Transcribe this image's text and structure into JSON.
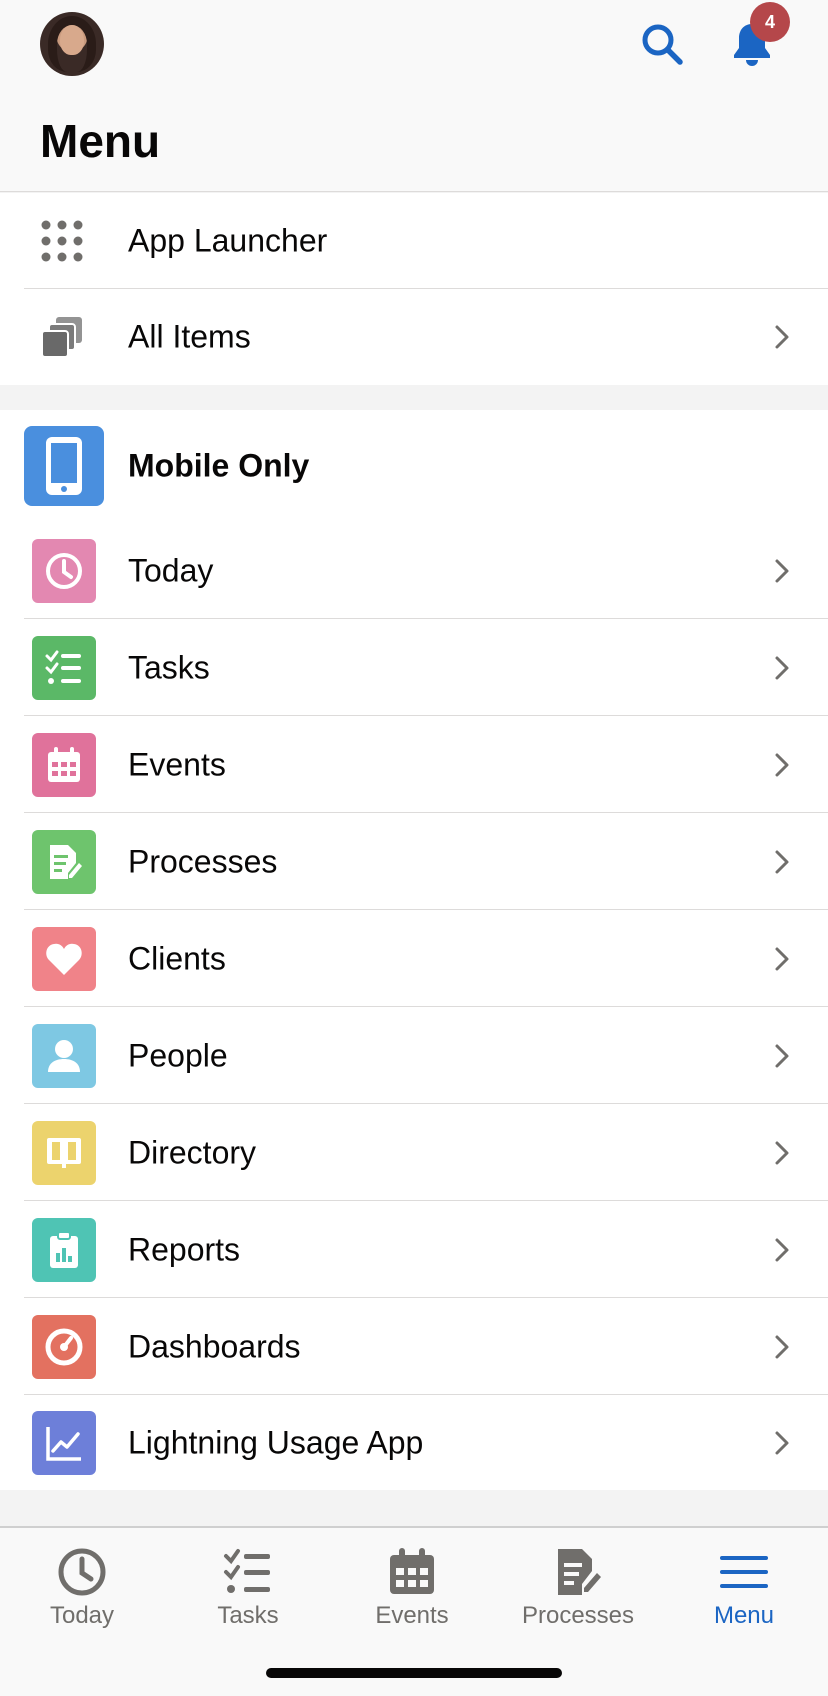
{
  "header": {
    "title": "Menu",
    "notification_count": "4"
  },
  "section1": {
    "items": [
      {
        "label": "App Launcher",
        "icon": "app-launcher-icon"
      },
      {
        "label": "All Items",
        "icon": "all-items-icon"
      }
    ]
  },
  "section2": {
    "heading": "Mobile Only",
    "items": [
      {
        "label": "Today",
        "icon": "clock-icon",
        "color": "#e388b1"
      },
      {
        "label": "Tasks",
        "icon": "task-list-icon",
        "color": "#5bb867"
      },
      {
        "label": "Events",
        "icon": "calendar-icon",
        "color": "#e0729b"
      },
      {
        "label": "Processes",
        "icon": "process-icon",
        "color": "#6ec46d"
      },
      {
        "label": "Clients",
        "icon": "heart-icon",
        "color": "#f08389"
      },
      {
        "label": "People",
        "icon": "person-icon",
        "color": "#7ec8e3"
      },
      {
        "label": "Directory",
        "icon": "book-icon",
        "color": "#ecd36d"
      },
      {
        "label": "Reports",
        "icon": "report-icon",
        "color": "#4fc4b4"
      },
      {
        "label": "Dashboards",
        "icon": "gauge-icon",
        "color": "#e37160"
      },
      {
        "label": "Lightning Usage App",
        "icon": "line-chart-icon",
        "color": "#6d7fd9"
      }
    ]
  },
  "tabbar": {
    "tabs": [
      {
        "label": "Today",
        "active": false
      },
      {
        "label": "Tasks",
        "active": false
      },
      {
        "label": "Events",
        "active": false
      },
      {
        "label": "Processes",
        "active": false
      },
      {
        "label": "Menu",
        "active": true
      }
    ]
  },
  "colors": {
    "accent": "#1b65c3",
    "badge": "#b5474a",
    "mobile_only_tile": "#4a8fde"
  }
}
